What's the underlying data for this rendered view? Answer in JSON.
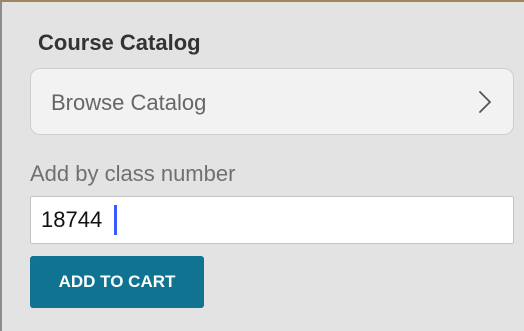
{
  "section": {
    "title": "Course Catalog"
  },
  "browse": {
    "label": "Browse Catalog",
    "icon": "chevron-right-icon"
  },
  "add_by_class": {
    "label": "Add by class number",
    "value": "18744",
    "button_label": "ADD TO CART"
  },
  "colors": {
    "background": "#e3e3e3",
    "button": "#0f7391",
    "caret": "#3a5bff"
  }
}
